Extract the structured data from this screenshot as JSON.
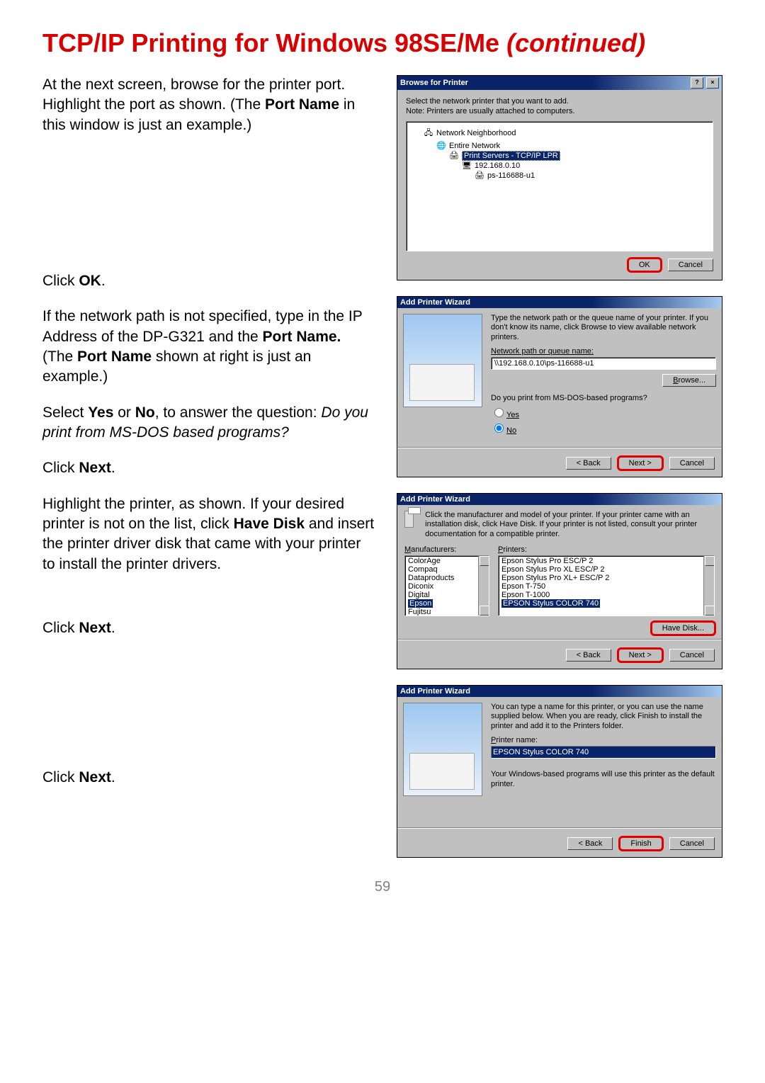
{
  "title_main": "TCP/IP Printing for Windows 98SE/Me ",
  "title_cont": "(continued)",
  "page_number": "59",
  "left": {
    "p1a": "At the next screen, browse for the printer port. Highlight the port as shown. (The ",
    "p1b": "Port Name",
    "p1c": " in this window is just an example.)",
    "p2a": "Click ",
    "p2b": "OK",
    "p2c": ".",
    "p3a": "If the network path is not specified, type in the IP Address of the DP-G321 and the ",
    "p3b": "Port Name.",
    "p3c": " (The ",
    "p3d": "Port Name",
    "p3e": " shown at right is just an example.)",
    "p4a": "Select ",
    "p4b": "Yes",
    "p4c": " or ",
    "p4d": "No",
    "p4e": ", to answer the question: ",
    "p4f": "Do you print from MS-DOS based programs?",
    "p5a": "Click  ",
    "p5b": "Next",
    "p5c": ".",
    "p6a": "Highlight the printer, as shown. If your desired printer is not on the list, click ",
    "p6b": "Have Disk",
    "p6c": " and insert the printer driver disk that came with your printer to install the printer drivers.",
    "p7a": "Click  ",
    "p7b": "Next",
    "p7c": ".",
    "p8a": "Click  ",
    "p8b": "Next",
    "p8c": "."
  },
  "browse": {
    "title": "Browse for Printer",
    "help": "?",
    "close": "×",
    "intro1": "Select the network printer that you want to add.",
    "intro2": "Note: Printers are usually attached to computers.",
    "tree": {
      "n1": "Network Neighborhood",
      "n2": "Entire Network",
      "n3": "Print Servers - TCP/IP LPR",
      "n4": "192.168.0.10",
      "n5": "ps-116688-u1"
    },
    "ok": "OK",
    "cancel": "Cancel"
  },
  "wiz1": {
    "title": "Add Printer Wizard",
    "desc": "Type the network path or the queue name of your printer. If you don't know its name, click Browse to view available network printers.",
    "path_lbl": "Network path or queue name:",
    "path_value": "\\\\192.168.0.10\\ps-116688-u1",
    "browse": "Browse...",
    "q": "Do you print from MS-DOS-based programs?",
    "yes": "Yes",
    "no": "No",
    "back": "< Back",
    "next": "Next >",
    "cancel": "Cancel"
  },
  "wiz2": {
    "title": "Add Printer Wizard",
    "desc": "Click the manufacturer and model of your printer. If your printer came with an installation disk, click Have Disk. If your printer is not listed, consult your printer documentation for a compatible printer.",
    "mfr_lbl": "Manufacturers:",
    "prn_lbl": "Printers:",
    "mfrs": [
      "ColorAge",
      "Compaq",
      "Dataproducts",
      "Diconix",
      "Digital",
      "Epson",
      "Fujitsu"
    ],
    "mfr_selected": "Epson",
    "prns": [
      "Epson Stylus Pro ESC/P 2",
      "Epson Stylus Pro XL ESC/P 2",
      "Epson Stylus Pro XL+ ESC/P 2",
      "Epson T-750",
      "Epson T-1000",
      "EPSON Stylus COLOR 740"
    ],
    "prn_selected": "EPSON Stylus COLOR 740",
    "have_disk": "Have Disk...",
    "back": "< Back",
    "next": "Next >",
    "cancel": "Cancel"
  },
  "wiz3": {
    "title": "Add Printer Wizard",
    "desc": "You can type a name for this printer, or you can use the name supplied below. When you are ready, click Finish to install the printer and add it to the Printers folder.",
    "name_lbl": "Printer name:",
    "name_value": "EPSON Stylus COLOR 740",
    "note": "Your Windows-based programs will use this printer as the default printer.",
    "back": "< Back",
    "finish": "Finish",
    "cancel": "Cancel"
  }
}
